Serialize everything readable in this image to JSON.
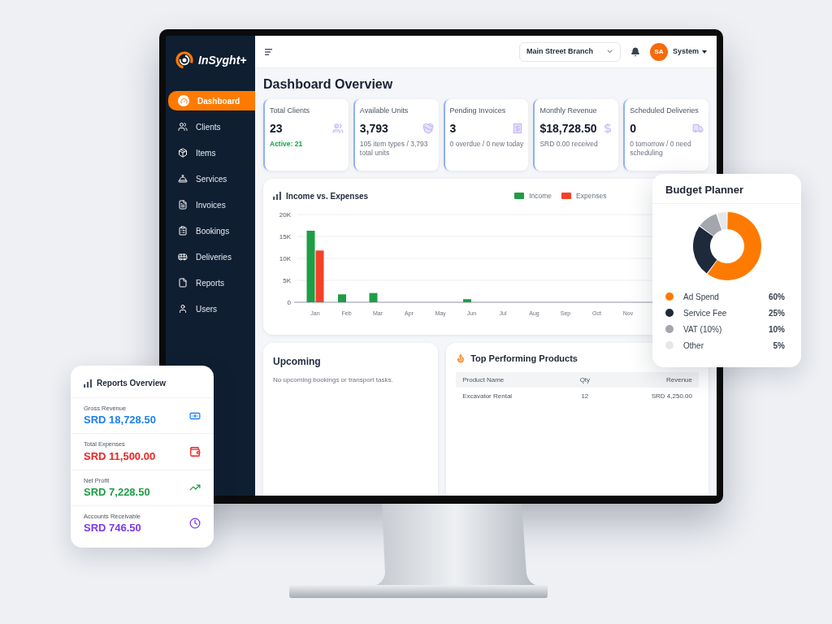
{
  "sidebar": {
    "logo_text": "InSyght+",
    "items": [
      {
        "label": "Dashboard",
        "selected": true
      },
      {
        "label": "Clients",
        "selected": false
      },
      {
        "label": "Items",
        "selected": false
      },
      {
        "label": "Services",
        "selected": false
      },
      {
        "label": "Invoices",
        "selected": false
      },
      {
        "label": "Bookings",
        "selected": false
      },
      {
        "label": "Deliveries",
        "selected": false
      },
      {
        "label": "Reports",
        "selected": false
      },
      {
        "label": "Users",
        "selected": false
      }
    ]
  },
  "top_bar": {
    "branch_select": {
      "value": "Main Street Branch"
    },
    "user": {
      "initials": "SA",
      "name": "System"
    }
  },
  "page_title": "Dashboard Overview",
  "stat_cards": [
    {
      "label": "Total Clients",
      "value": "23",
      "note": "Active: 21",
      "positive": true
    },
    {
      "label": "Available Units",
      "value": "3,793",
      "note": "105 item types / 3,793 total units",
      "positive": false
    },
    {
      "label": "Pending Invoices",
      "value": "3",
      "note": "0 overdue / 0 new today",
      "positive": false
    },
    {
      "label": "Monthly Revenue",
      "value": "$18,728.50",
      "note": "SRD 0.00 received",
      "positive": false
    },
    {
      "label": "Scheduled Deliveries",
      "value": "0",
      "note": "0 tomorrow / 0 need scheduling",
      "positive": false
    }
  ],
  "income_chart": {
    "chart_data": {
      "type": "bar",
      "title": "Income vs. Expenses",
      "categories": [
        "Jan",
        "Feb",
        "Mar",
        "Apr",
        "May",
        "Jun",
        "Jul",
        "Aug",
        "Sep",
        "Oct",
        "Nov"
      ],
      "series": [
        {
          "name": "Income",
          "color": "#1f9d45",
          "values": [
            16300,
            1800,
            2100,
            0,
            0,
            700,
            0,
            0,
            0,
            0,
            0
          ]
        },
        {
          "name": "Expenses",
          "color": "#f4402a",
          "values": [
            11800,
            0,
            0,
            0,
            0,
            0,
            0,
            0,
            0,
            0,
            0
          ]
        }
      ],
      "ylim": [
        0,
        20000
      ],
      "yticks": [
        {
          "value": 0,
          "label": "0"
        },
        {
          "value": 5000,
          "label": "5K"
        },
        {
          "value": 10000,
          "label": "10K"
        },
        {
          "value": 15000,
          "label": "15K"
        },
        {
          "value": 20000,
          "label": "20K"
        }
      ],
      "grid": true
    }
  },
  "upcoming": {
    "title": "Upcoming",
    "message": "No upcoming bookings or transport tasks."
  },
  "top_products": {
    "title": "Top Performing Products",
    "columns": [
      "Product Name",
      "Qty",
      "Revenue"
    ],
    "rows": [
      [
        "Excavator Rental",
        "12",
        "SRD 4,250.00"
      ]
    ]
  },
  "budget_planner": {
    "title": "Budget Planner",
    "chart_data": {
      "type": "donut",
      "categories": [
        "Ad Spend",
        "Service Fee",
        "VAT (10%)",
        "Other"
      ],
      "values": [
        60,
        25,
        10,
        5
      ]
    },
    "legend": [
      {
        "percent": "60%",
        "color": "#ff7a00"
      },
      {
        "percent": "25%",
        "color": "#1e293b"
      },
      {
        "percent": "10%",
        "color": "#a3a6ad"
      },
      {
        "percent": "5%",
        "color": "#e5e7eb"
      }
    ]
  },
  "reports_overview": {
    "title": "Reports Overview",
    "items": [
      {
        "label": "Gross Revenue",
        "value": "SRD 18,728.50",
        "color": "#1d7ff0"
      },
      {
        "label": "Total Expenses",
        "value": "SRD 11,500.00",
        "color": "#ef2323"
      },
      {
        "label": "Net Profit",
        "value": "SRD 7,228.50",
        "color": "#1f9d45"
      },
      {
        "label": "Accounts Receivable",
        "value": "SRD 746.50",
        "color": "#7c3aed"
      }
    ]
  }
}
